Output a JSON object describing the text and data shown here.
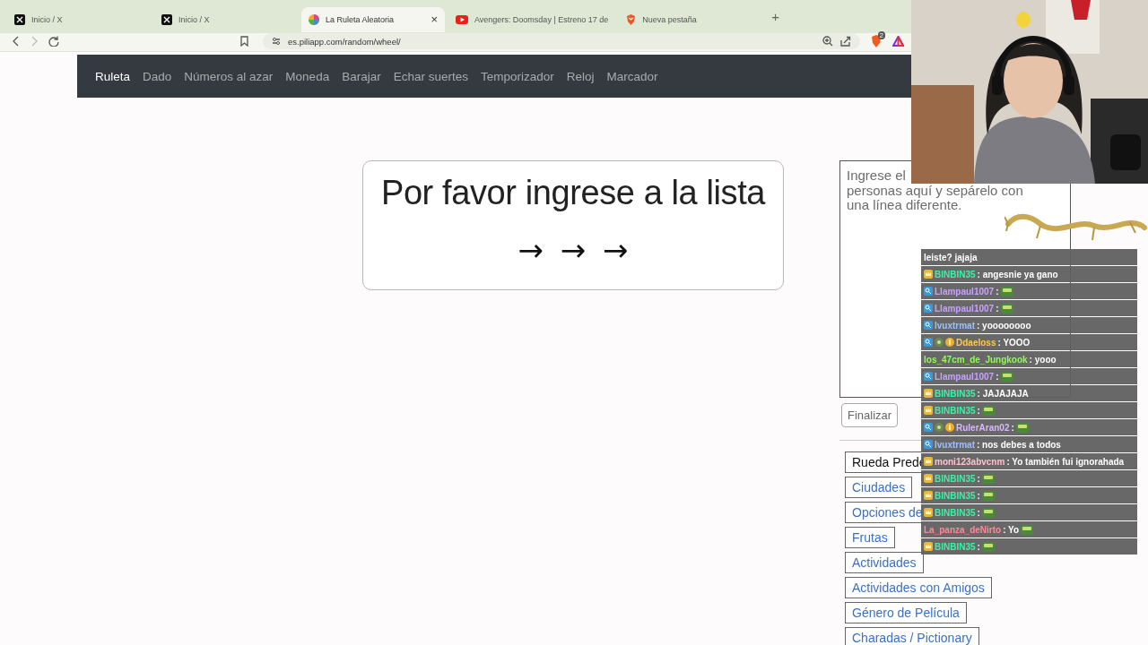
{
  "tabs": [
    {
      "kind": "x",
      "label": "Inicio / X",
      "selected": false
    },
    {
      "kind": "x",
      "label": "Inicio / X",
      "selected": false
    },
    {
      "kind": "wheel",
      "label": "La Ruleta Aleatoria",
      "selected": true,
      "close": "×"
    },
    {
      "kind": "youtube",
      "label": "Avengers: Doomsday | Estreno 17 de",
      "selected": false
    },
    {
      "kind": "brave",
      "label": "Nueva pestaña",
      "selected": false
    }
  ],
  "new_tab": "+",
  "address_bar": {
    "url": "es.piliapp.com/random/wheel/",
    "shield_badge": "2"
  },
  "navbar": [
    {
      "label": "Ruleta",
      "selected": true
    },
    {
      "label": "Dado",
      "selected": false
    },
    {
      "label": "Números al azar",
      "selected": false
    },
    {
      "label": "Moneda",
      "selected": false
    },
    {
      "label": "Barajar",
      "selected": false
    },
    {
      "label": "Echar suertes",
      "selected": false
    },
    {
      "label": "Temporizador",
      "selected": false
    },
    {
      "label": "Reloj",
      "selected": false
    },
    {
      "label": "Marcador",
      "selected": false
    }
  ],
  "wheel_card": {
    "prompt": "Por favor ingrese a la lista",
    "arrows": "→ → →"
  },
  "entry_panel": {
    "placeholder": "Ingrese el\npersonas aquí y sepárelo con\nuna línea diferente.",
    "finish_button": "Finalizar",
    "presets": [
      {
        "label": "Rueda Prede",
        "kind": "default",
        "covered": true
      },
      {
        "label": "Ciudades",
        "kind": "link",
        "covered": false
      },
      {
        "label": "Opciones de",
        "kind": "link",
        "covered": true
      },
      {
        "label": "Frutas",
        "kind": "link",
        "covered": false
      },
      {
        "label": "Actividades",
        "kind": "link",
        "covered": false
      },
      {
        "label": "Actividades con Amigos",
        "kind": "link",
        "covered": false
      },
      {
        "label": "Género de Película",
        "kind": "link",
        "covered": false
      },
      {
        "label": "Charadas / Pictionary",
        "kind": "link",
        "covered": false
      }
    ]
  },
  "chat": [
    {
      "text": "leiste? jajaja"
    },
    {
      "badges": [
        {
          "kind": "crown"
        }
      ],
      "user": "BINBIN35",
      "color": "#3ff0a8",
      "text": ": angesnie ya gano"
    },
    {
      "badges": [
        {
          "kind": "magnifier"
        }
      ],
      "user": "Llampaul1007",
      "color": "#c8a0ff",
      "text": ":",
      "emote": true
    },
    {
      "badges": [
        {
          "kind": "magnifier"
        }
      ],
      "user": "Llampaul1007",
      "color": "#c8a0ff",
      "text": ":",
      "emote": true
    },
    {
      "badges": [
        {
          "kind": "magnifier"
        }
      ],
      "user": "lvuxtrmat",
      "color": "#9cc0ff",
      "text": ": yoooooooo"
    },
    {
      "badges": [
        {
          "kind": "magnifier"
        },
        {
          "kind": "gear"
        },
        {
          "kind": "coin"
        }
      ],
      "user": "Ddaeloss",
      "color": "#ffc850",
      "text": ": YOOO"
    },
    {
      "user": "los_47cm_de_Jungkook",
      "color": "#8cff50",
      "text": ": yooo"
    },
    {
      "badges": [
        {
          "kind": "magnifier"
        }
      ],
      "user": "Llampaul1007",
      "color": "#c8a0ff",
      "text": ":",
      "emote": true
    },
    {
      "badges": [
        {
          "kind": "crown"
        }
      ],
      "user": "BINBIN35",
      "color": "#3ff0a8",
      "text": ": JAJAJAJA"
    },
    {
      "badges": [
        {
          "kind": "crown"
        }
      ],
      "user": "BINBIN35",
      "color": "#3ff0a8",
      "text": ":",
      "emote": true
    },
    {
      "badges": [
        {
          "kind": "magnifier"
        },
        {
          "kind": "gear"
        },
        {
          "kind": "coin"
        }
      ],
      "user": "RulerAran02",
      "color": "#d8b8ff",
      "text": ":",
      "emote": true
    },
    {
      "badges": [
        {
          "kind": "magnifier"
        }
      ],
      "user": "lvuxtrmat",
      "color": "#9cc0ff",
      "text": ": nos debes a todos"
    },
    {
      "badges": [
        {
          "kind": "crown"
        }
      ],
      "user": "moni123abvcnm",
      "color": "#ffc0d0",
      "text": ": Yo también fui ignorahada"
    },
    {
      "badges": [
        {
          "kind": "crown"
        }
      ],
      "user": "BINBIN35",
      "color": "#3ff0a8",
      "text": ":",
      "emote": true
    },
    {
      "badges": [
        {
          "kind": "crown"
        }
      ],
      "user": "BINBIN35",
      "color": "#3ff0a8",
      "text": ":",
      "emote": true
    },
    {
      "badges": [
        {
          "kind": "crown"
        }
      ],
      "user": "BINBIN35",
      "color": "#3ff0a8",
      "text": ":",
      "emote": true
    },
    {
      "user": "La_panza_deNirto",
      "color": "#ff8898",
      "text": ": Yo",
      "emote": true
    },
    {
      "badges": [
        {
          "kind": "crown"
        }
      ],
      "user": "BINBIN35",
      "color": "#3ff0a8",
      "text": ":",
      "emote": true
    }
  ]
}
